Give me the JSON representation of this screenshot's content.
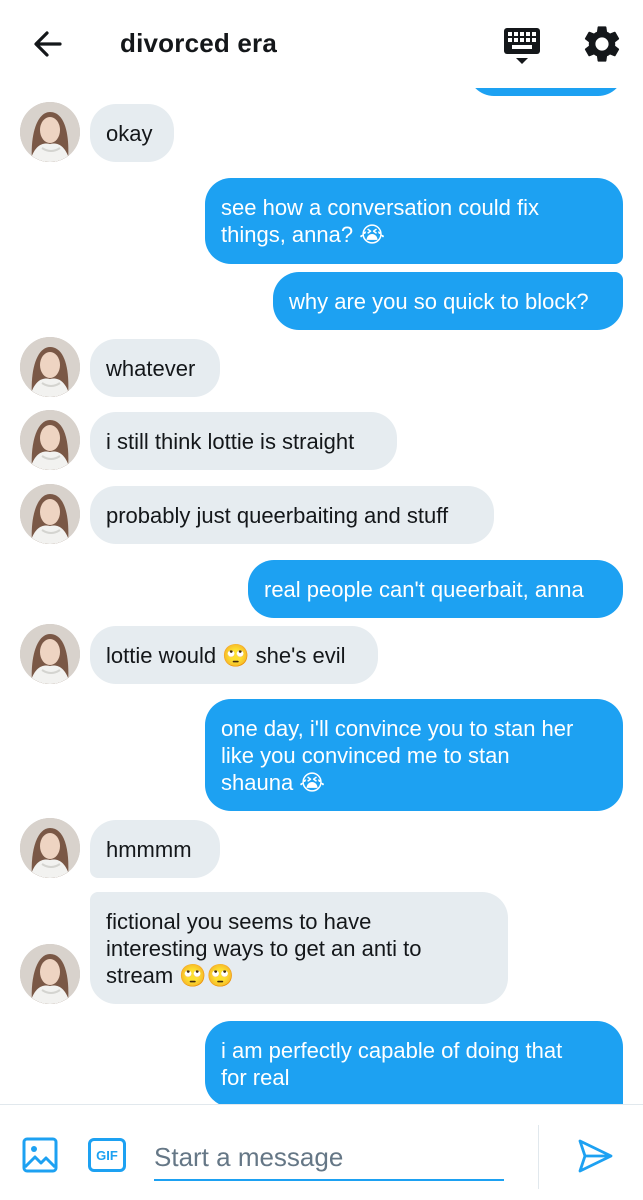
{
  "header": {
    "title": "divorced era"
  },
  "messages": [
    {
      "side": "in",
      "text": "okay"
    },
    {
      "side": "out",
      "text": "see how a conversation could fix\nthings, anna? 😭"
    },
    {
      "side": "out",
      "text": "why are you so quick to block?"
    },
    {
      "side": "in",
      "text": "whatever"
    },
    {
      "side": "in",
      "text": "i still think lottie is straight"
    },
    {
      "side": "in",
      "text": "probably just queerbaiting and stuff"
    },
    {
      "side": "out",
      "text": "real people can't queerbait, anna"
    },
    {
      "side": "in",
      "text": "lottie would 🙄 she's evil"
    },
    {
      "side": "out",
      "text": "one day, i'll convince you to stan her\nlike you convinced me to stan\nshauna 😭"
    },
    {
      "side": "in",
      "text": "hmmmm"
    },
    {
      "side": "in",
      "text": "fictional you seems to have\ninteresting ways to get an anti to\nstream 🙄🙄"
    },
    {
      "side": "out",
      "text": "i am perfectly capable of doing that\nfor real"
    }
  ],
  "composer": {
    "placeholder": "Start a message",
    "gif_label": "GIF"
  },
  "colors": {
    "accent": "#1da1f2",
    "incoming_bubble": "#e6ecf0",
    "text": "#14171a",
    "placeholder": "#657786"
  },
  "icons": [
    "back-arrow-icon",
    "keyboard-icon",
    "gear-icon",
    "image-icon",
    "gif-icon",
    "send-icon",
    "avatar"
  ]
}
